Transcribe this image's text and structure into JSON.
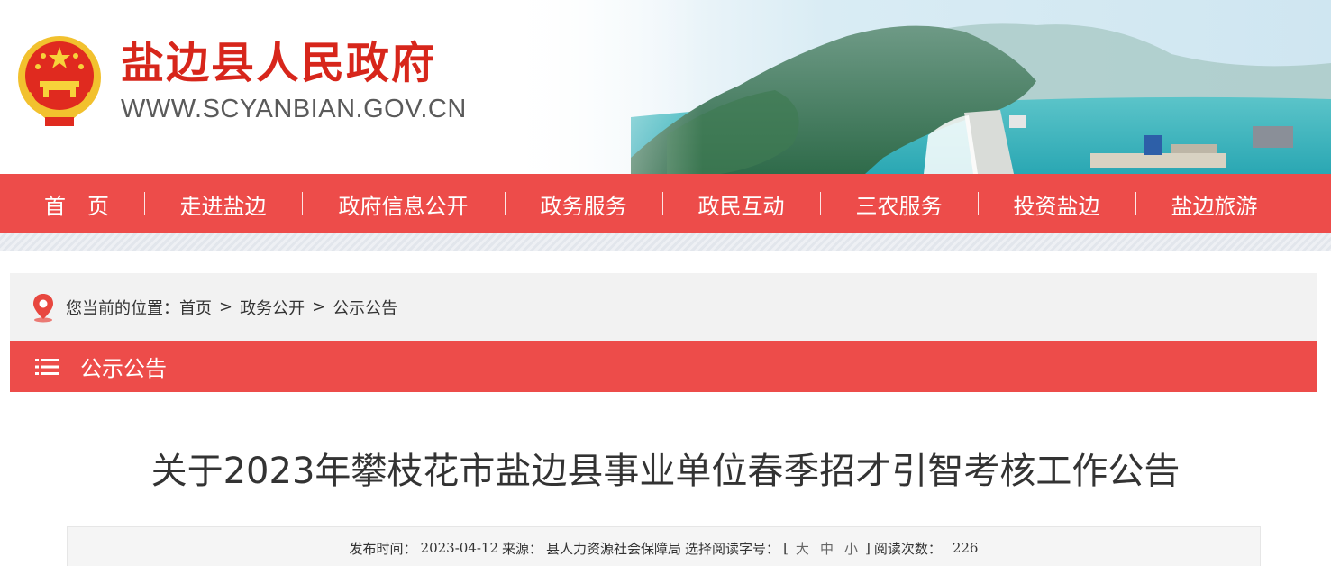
{
  "header": {
    "site_title": "盐边县人民政府",
    "site_url": "WWW.SCYANBIAN.GOV.CN",
    "emblem_icon": "national-emblem-icon"
  },
  "nav": {
    "items": [
      {
        "label": "首　页"
      },
      {
        "label": "走进盐边"
      },
      {
        "label": "政府信息公开"
      },
      {
        "label": "政务服务"
      },
      {
        "label": "政民互动"
      },
      {
        "label": "三农服务"
      },
      {
        "label": "投资盐边"
      },
      {
        "label": "盐边旅游"
      }
    ]
  },
  "breadcrumb": {
    "prefix": "您当前的位置：",
    "items": [
      {
        "label": "首页"
      },
      {
        "label": "政务公开"
      },
      {
        "label": "公示公告"
      }
    ],
    "separator": ">",
    "icon": "location-pin-icon"
  },
  "section": {
    "title": "公示公告",
    "icon": "list-icon"
  },
  "article": {
    "title": "关于2023年攀枝花市盐边县事业单位春季招才引智考核工作公告",
    "meta": {
      "publish_label": "发布时间：",
      "publish_date": "2023-04-12",
      "source_label": "来源：",
      "source": "县人力资源社会保障局",
      "font_size_label": "选择阅读字号：",
      "bracket_open": "[",
      "size_large": "大",
      "size_medium": "中",
      "size_small": "小",
      "bracket_close": "]",
      "views_label": "阅读次数：",
      "views": "226"
    }
  },
  "colors": {
    "nav_bg": "#ed4c4a",
    "title_red": "#d7261b",
    "crumb_bg": "#f2f2f2"
  }
}
